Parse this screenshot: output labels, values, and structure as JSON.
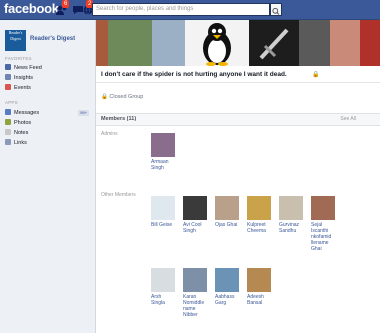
{
  "topbar": {
    "logo": "facebook",
    "friend_badge": "6",
    "notif_badge": "2",
    "search_placeholder": "Search for people, places and things"
  },
  "sidebar": {
    "page_logo_text": "Reader's Digest",
    "page_name": "Reader's Digest",
    "favorites_title": "FAVORITES",
    "favorites": [
      {
        "label": "News Feed",
        "icon": "news-feed-icon"
      },
      {
        "label": "Insights",
        "icon": "insights-icon"
      },
      {
        "label": "Events",
        "icon": "events-icon"
      }
    ],
    "apps_title": "APPS",
    "apps": [
      {
        "label": "Messages",
        "icon": "messages-icon",
        "count": "99+"
      },
      {
        "label": "Photos",
        "icon": "photos-icon"
      },
      {
        "label": "Notes",
        "icon": "notes-icon"
      },
      {
        "label": "Links",
        "icon": "links-icon"
      }
    ]
  },
  "group": {
    "title": "I don't care if the spider is not hurting anyone I want it dead.",
    "privacy": "Closed Group"
  },
  "members": {
    "header": "Members (11)",
    "see_all": "See All",
    "admins_label": "Admins",
    "others_label": "Other Members",
    "admins": [
      {
        "name": "Armaan\nSingh",
        "color": "#8a6d8c"
      }
    ],
    "others": [
      {
        "name": "Bill Geise",
        "color": "#dfe8ef"
      },
      {
        "name": "Avi Cool\nSingh",
        "color": "#3a3a3a"
      },
      {
        "name": "Ojas Ghai",
        "color": "#b9a08a"
      },
      {
        "name": "Kulpreet\nCheema",
        "color": "#c9a24a"
      },
      {
        "name": "Gurvinaz\nSandhu",
        "color": "#c8bfae"
      },
      {
        "name": "Sejal\nIscanthi\nnkofamid\nllename\nGhai",
        "color": "#a06a55"
      },
      {
        "name": "Arsh\nSingla",
        "color": "#d8dde2"
      },
      {
        "name": "Karan\nNomiddle\nname\nNibber",
        "color": "#7e90a8"
      },
      {
        "name": "Aabhass\nGarg",
        "color": "#6b93b5"
      },
      {
        "name": "Adeesh\nBansal",
        "color": "#b58a52"
      }
    ]
  },
  "cover_tiles": [
    {
      "color": "#a85b3c"
    },
    {
      "color": "#6f8a5a"
    },
    {
      "color": "#9bb0c4"
    },
    {
      "color": "#f1f1f1"
    },
    {
      "color": "#1f1f1f"
    },
    {
      "color": "#5a5a5a"
    },
    {
      "color": "#c98a7a"
    },
    {
      "color": "#b0302a"
    }
  ]
}
